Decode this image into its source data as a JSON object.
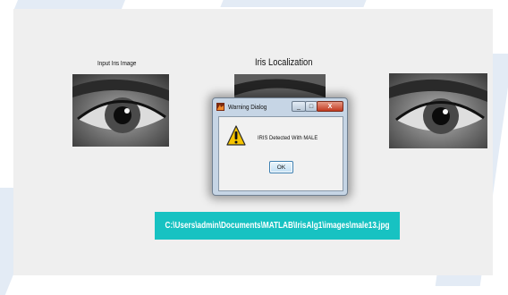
{
  "figure": {
    "input_label": "Input Iris Image",
    "localization_label": "Iris Localization",
    "image_path": "C:\\Users\\admin\\Documents\\MATLAB\\IrisAlg1\\images\\male13.jpg"
  },
  "dialog": {
    "title": "Warning Dialog",
    "message": "IRIS Detected With MALE",
    "ok_label": "OK",
    "close_glyph": "X",
    "minimize_glyph": "_",
    "maximize_glyph": "□",
    "icon": "warning-icon"
  },
  "colors": {
    "path_background": "#17c2c2",
    "figure_background": "#efefef",
    "dialog_frame": "#c6d5e5"
  }
}
